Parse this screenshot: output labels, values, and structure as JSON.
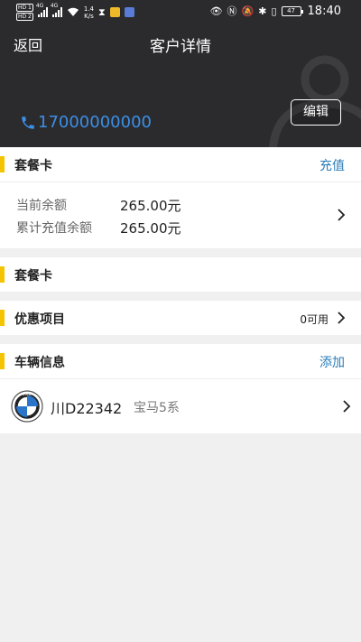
{
  "status_bar": {
    "hd1": "HD 1",
    "hd2": "HD 2",
    "net1": "4G",
    "net2": "4G",
    "speed_value": "1.4",
    "speed_unit": "K/s",
    "battery": "47",
    "time": "18:40"
  },
  "nav": {
    "back_label": "返回",
    "title": "客户详情"
  },
  "profile": {
    "phone": "17000000000",
    "edit_label": "编辑"
  },
  "package_card": {
    "title": "套餐卡",
    "action": "充值",
    "balance_label": "当前余额",
    "balance_value": "265.00元",
    "recharge_label": "累计充值余额",
    "recharge_value": "265.00元"
  },
  "package_card2": {
    "title": "套餐卡"
  },
  "discount": {
    "title": "优惠项目",
    "available": "0可用"
  },
  "vehicle": {
    "title": "车辆信息",
    "action": "添加",
    "plate": "川D22342",
    "model": "宝马5系",
    "logo_text": "BMW"
  },
  "colors": {
    "header_bg": "#2b2b2d",
    "accent_yellow": "#f5c400",
    "link_blue": "#2a7cb8",
    "phone_blue": "#3b8fe8"
  }
}
